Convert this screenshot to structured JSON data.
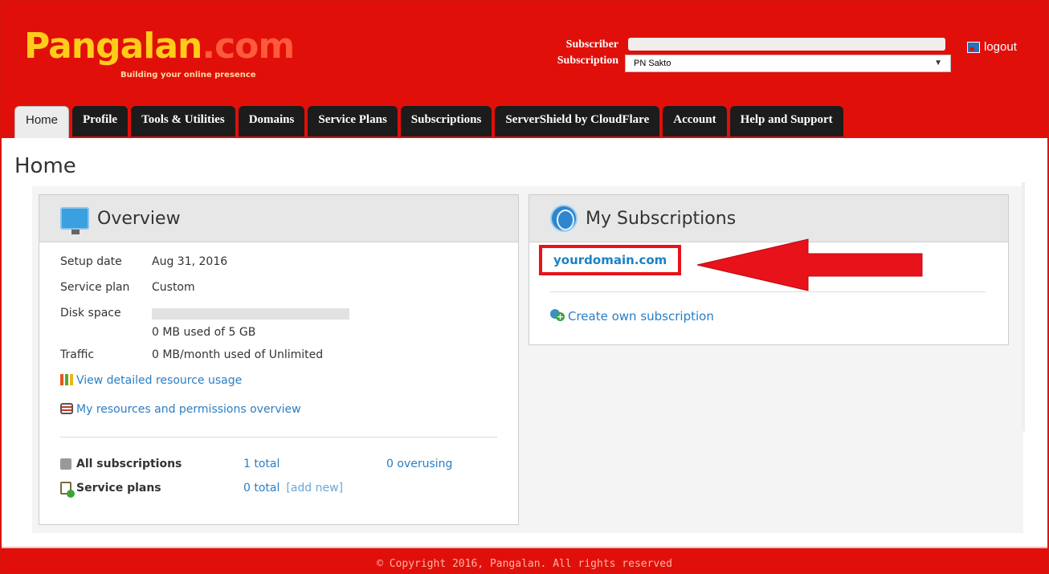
{
  "brand": {
    "logo_part1": "Pangalan",
    "logo_part2": ".com",
    "tagline": "Building your online presence"
  },
  "header": {
    "subscriber_label": "Subscriber",
    "subscription_label": "Subscription",
    "subscription_value": "PN Sakto",
    "logout_label": "logout"
  },
  "tabs": [
    "Home",
    "Profile",
    "Tools & Utilities",
    "Domains",
    "Service Plans",
    "Subscriptions",
    "ServerShield by CloudFlare",
    "Account",
    "Help and Support"
  ],
  "page": {
    "title": "Home"
  },
  "overview": {
    "title": "Overview",
    "setup_label": "Setup date",
    "setup_value": "Aug 31, 2016",
    "plan_label": "Service plan",
    "plan_value": "Custom",
    "disk_label": "Disk space",
    "disk_value": "0 MB used of 5 GB",
    "disk_used_fraction": 0,
    "traffic_label": "Traffic",
    "traffic_value": "0 MB/month used of Unlimited",
    "view_usage_link": "View detailed resource usage",
    "resources_link": "My resources and permissions overview",
    "all_subs_label": "All subscriptions",
    "all_subs_total": "1 total",
    "all_subs_overusing": "0 overusing",
    "service_plans_label": "Service plans",
    "service_plans_total": "0 total",
    "service_plans_add": "[add new]"
  },
  "subscriptions": {
    "title": "My Subscriptions",
    "domain_link": "yourdomain.com",
    "create_link": "Create own subscription"
  },
  "footer": {
    "text": "© Copyright 2016, Pangalan. All rights reserved"
  },
  "colors": {
    "header_red": "#e10f0a",
    "tab_dark": "#1c1c1c",
    "link_blue": "#2a7ec4",
    "highlight_red": "#e8121a"
  }
}
